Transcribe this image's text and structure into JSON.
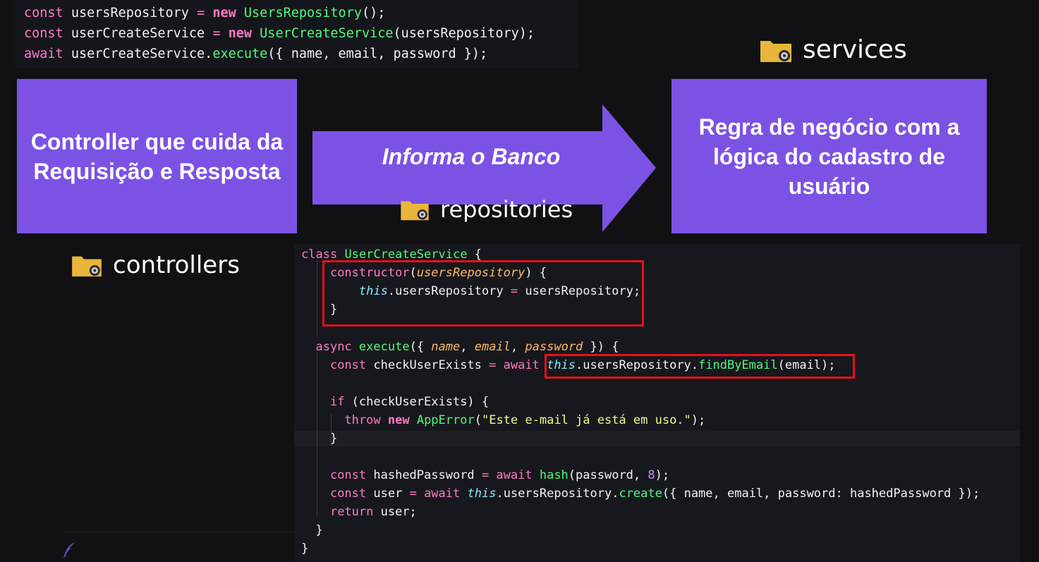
{
  "top_code": {
    "lines": [
      [
        {
          "t": "const",
          "c": "kw"
        },
        {
          "t": " usersRepository ",
          "c": ""
        },
        {
          "t": "=",
          "c": "op"
        },
        {
          "t": " ",
          "c": ""
        },
        {
          "t": "new",
          "c": "kwb"
        },
        {
          "t": " ",
          "c": ""
        },
        {
          "t": "UsersRepository",
          "c": "cls"
        },
        {
          "t": "();",
          "c": ""
        }
      ],
      [
        {
          "t": "const",
          "c": "kw"
        },
        {
          "t": " userCreateService ",
          "c": ""
        },
        {
          "t": "=",
          "c": "op"
        },
        {
          "t": " ",
          "c": ""
        },
        {
          "t": "new",
          "c": "kwb"
        },
        {
          "t": " ",
          "c": ""
        },
        {
          "t": "UserCreateService",
          "c": "cls"
        },
        {
          "t": "(usersRepository);",
          "c": ""
        }
      ],
      [
        {
          "t": "await",
          "c": "kw"
        },
        {
          "t": " userCreateService.",
          "c": ""
        },
        {
          "t": "execute",
          "c": "fn"
        },
        {
          "t": "({ name, email, password });",
          "c": ""
        }
      ]
    ]
  },
  "boxes": {
    "controller": "Controller que cuida da Requisição e Resposta",
    "service": "Regra de negócio com a lógica do cadastro de usuário"
  },
  "arrow_label": "Informa o Banco",
  "folders": {
    "services": "services",
    "repositories": "repositories",
    "controllers": "controllers"
  },
  "colors": {
    "box_purple": "#7c52e5",
    "highlight_red": "#e8101a",
    "folder_yellow": "#e9b53a"
  },
  "main_code": {
    "lines": [
      [
        {
          "t": "class",
          "c": "kw"
        },
        {
          "t": " ",
          "c": ""
        },
        {
          "t": "UserCreateService",
          "c": "cls"
        },
        {
          "t": " {",
          "c": ""
        }
      ],
      [
        {
          "t": "    ",
          "c": ""
        },
        {
          "t": "constructor",
          "c": "kw"
        },
        {
          "t": "(",
          "c": ""
        },
        {
          "t": "usersRepository",
          "c": "prm"
        },
        {
          "t": ") {",
          "c": ""
        }
      ],
      [
        {
          "t": "        ",
          "c": ""
        },
        {
          "t": "this",
          "c": "ths"
        },
        {
          "t": ".usersRepository ",
          "c": ""
        },
        {
          "t": "=",
          "c": "op"
        },
        {
          "t": " usersRepository;",
          "c": ""
        }
      ],
      [
        {
          "t": "    }",
          "c": ""
        }
      ],
      [],
      [
        {
          "t": "  ",
          "c": ""
        },
        {
          "t": "async",
          "c": "kw"
        },
        {
          "t": " ",
          "c": ""
        },
        {
          "t": "execute",
          "c": "fn"
        },
        {
          "t": "({ ",
          "c": ""
        },
        {
          "t": "name",
          "c": "prm"
        },
        {
          "t": ", ",
          "c": ""
        },
        {
          "t": "email",
          "c": "prm"
        },
        {
          "t": ", ",
          "c": ""
        },
        {
          "t": "password",
          "c": "prm"
        },
        {
          "t": " }) {",
          "c": ""
        }
      ],
      [
        {
          "t": "    ",
          "c": ""
        },
        {
          "t": "const",
          "c": "kw"
        },
        {
          "t": " checkUserExists ",
          "c": ""
        },
        {
          "t": "=",
          "c": "op"
        },
        {
          "t": " ",
          "c": ""
        },
        {
          "t": "await",
          "c": "kw"
        },
        {
          "t": " ",
          "c": ""
        },
        {
          "t": "this",
          "c": "ths"
        },
        {
          "t": ".usersRepository.",
          "c": ""
        },
        {
          "t": "findByEmail",
          "c": "fn"
        },
        {
          "t": "(email);",
          "c": ""
        }
      ],
      [],
      [
        {
          "t": "    ",
          "c": ""
        },
        {
          "t": "if",
          "c": "kw"
        },
        {
          "t": " (checkUserExists) {",
          "c": ""
        }
      ],
      [
        {
          "t": "      ",
          "c": ""
        },
        {
          "t": "throw",
          "c": "kw"
        },
        {
          "t": " ",
          "c": ""
        },
        {
          "t": "new",
          "c": "kwb"
        },
        {
          "t": " ",
          "c": ""
        },
        {
          "t": "AppError",
          "c": "cls"
        },
        {
          "t": "(",
          "c": ""
        },
        {
          "t": "\"Este e-mail já está em uso.\"",
          "c": "str"
        },
        {
          "t": ");",
          "c": ""
        }
      ],
      [
        {
          "t": "    }",
          "c": ""
        }
      ],
      [],
      [
        {
          "t": "    ",
          "c": ""
        },
        {
          "t": "const",
          "c": "kw"
        },
        {
          "t": " hashedPassword ",
          "c": ""
        },
        {
          "t": "=",
          "c": "op"
        },
        {
          "t": " ",
          "c": ""
        },
        {
          "t": "await",
          "c": "kw"
        },
        {
          "t": " ",
          "c": ""
        },
        {
          "t": "hash",
          "c": "fn"
        },
        {
          "t": "(password, ",
          "c": ""
        },
        {
          "t": "8",
          "c": "num"
        },
        {
          "t": ");",
          "c": ""
        }
      ],
      [
        {
          "t": "    ",
          "c": ""
        },
        {
          "t": "const",
          "c": "kw"
        },
        {
          "t": " user ",
          "c": ""
        },
        {
          "t": "=",
          "c": "op"
        },
        {
          "t": " ",
          "c": ""
        },
        {
          "t": "await",
          "c": "kw"
        },
        {
          "t": " ",
          "c": ""
        },
        {
          "t": "this",
          "c": "ths"
        },
        {
          "t": ".usersRepository.",
          "c": ""
        },
        {
          "t": "create",
          "c": "fn"
        },
        {
          "t": "({ name, email, password: hashedPassword });",
          "c": ""
        }
      ],
      [
        {
          "t": "    ",
          "c": ""
        },
        {
          "t": "return",
          "c": "kw"
        },
        {
          "t": " user;",
          "c": ""
        }
      ],
      [
        {
          "t": "  }",
          "c": ""
        }
      ],
      [
        {
          "t": "}",
          "c": ""
        }
      ]
    ]
  }
}
